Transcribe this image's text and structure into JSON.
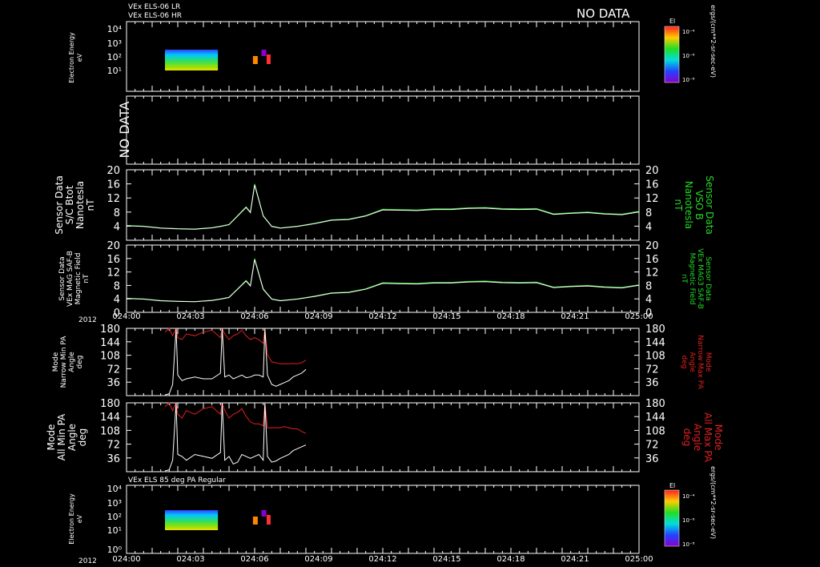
{
  "header": {
    "line1": "VEx ELS-06 LR",
    "line2": "VEx ELS-06 HR",
    "no_data": "NO DATA",
    "bottom_title": "VEx ELS 85 deg PA Regular",
    "flux_unit": "ergs/(cm**2-sr-sec-eV)",
    "year": "2012"
  },
  "colors": {
    "green": "#22dd22",
    "red": "#e02020",
    "white": "#ffffff",
    "frame": "#ffffff"
  },
  "colorbars": [
    {
      "label": "El",
      "ticks": [
        "10⁻⁴",
        "10⁻⁶",
        "10⁻⁸"
      ]
    },
    {
      "label": "El",
      "ticks": [
        "10⁻⁴",
        "10⁻⁶",
        "10⁻⁸"
      ]
    }
  ],
  "time_ticks": [
    "024:00",
    "024:03",
    "024:06",
    "024:09",
    "024:12",
    "024:15",
    "024:18",
    "024:21",
    "025:00"
  ],
  "panels": {
    "p1": {
      "ylabel": [
        "Electron Energy",
        "eV"
      ],
      "ticks": [
        "10⁴",
        "10³",
        "10²",
        "10¹"
      ]
    },
    "p2": {
      "ylabel": "NO DATA"
    },
    "p3": {
      "ylabel_left": [
        "Sensor Data",
        "S/C Btot",
        "Nanotesla",
        "nT"
      ],
      "ylabel_right": [
        "Sensor Data",
        "VSO B",
        "Nanotesla",
        "nT"
      ],
      "ticks": [
        "20",
        "16",
        "12",
        "8",
        "4"
      ]
    },
    "p4": {
      "ylabel_left": [
        "Sensor Data",
        "VEx MAG SAF-B",
        "Magnetic Field",
        "nT"
      ],
      "ylabel_right": [
        "Sensor Data",
        "VEx MAG3 SAF-B",
        "Magnetic Field",
        "nT"
      ],
      "ticks": [
        "20",
        "16",
        "12",
        "8",
        "4",
        "0"
      ]
    },
    "p5": {
      "ylabel_left": [
        "Mode",
        "Narrow Min PA",
        "Angle",
        "deg"
      ],
      "ylabel_right": [
        "Mode",
        "Narrow Max PA",
        "Angle",
        "deg"
      ],
      "ticks": [
        "180",
        "144",
        "108",
        "72",
        "36"
      ]
    },
    "p6": {
      "ylabel_left": [
        "Mode",
        "All Min PA",
        "Angle",
        "deg"
      ],
      "ylabel_right": [
        "Mode",
        "All Max PA",
        "Angle",
        "deg"
      ],
      "ticks": [
        "180",
        "144",
        "108",
        "72",
        "36"
      ]
    },
    "p7": {
      "ylabel": [
        "Electron Energy",
        "eV"
      ],
      "ticks": [
        "10⁴",
        "10³",
        "10²",
        "10¹",
        "10⁰"
      ]
    }
  },
  "chart_data": {
    "type": "line",
    "x_unit": "minutes after 024:00",
    "xlim": [
      0,
      60
    ],
    "spectrograms": [
      {
        "panel": "p1",
        "x_range": [
          4.5,
          10.7
        ],
        "energy_range_eV": [
          10,
          200
        ]
      },
      {
        "panel": "p7",
        "x_range": [
          4.5,
          10.7
        ],
        "energy_range_eV": [
          1,
          200
        ]
      }
    ],
    "b_field": {
      "ylim": [
        0,
        20
      ],
      "x": [
        0,
        2,
        4,
        6,
        8,
        10,
        11,
        12,
        13,
        14,
        14.5,
        15,
        16,
        17,
        18,
        20,
        22,
        24,
        26,
        28,
        30,
        32,
        34,
        36,
        38,
        40,
        42,
        44,
        46,
        48,
        50,
        52,
        54,
        56,
        58,
        60
      ],
      "values": [
        4.2,
        4,
        3.5,
        3.3,
        3.2,
        3.6,
        4,
        4.5,
        7,
        9.5,
        8,
        16,
        7,
        4,
        3.5,
        4,
        4.8,
        5.8,
        6,
        7,
        8.8,
        8.7,
        8.6,
        8.9,
        8.9,
        9.2,
        9.3,
        9,
        8.9,
        9,
        7.5,
        7.8,
        8,
        7.6,
        7.4,
        8.2
      ]
    },
    "narrow_pa": {
      "ylim": [
        0,
        180
      ],
      "x": [
        4.5,
        5,
        5.4,
        5.8,
        6,
        6.5,
        7,
        8,
        9,
        10,
        11,
        11.2,
        11.5,
        12,
        12.5,
        13,
        13.5,
        14,
        14.5,
        15,
        15.5,
        16,
        16.2,
        16.5,
        17,
        17.5,
        18,
        18.5,
        19,
        19.5,
        20,
        20.5,
        21
      ],
      "min": [
        2,
        5,
        30,
        180,
        55,
        40,
        45,
        50,
        45,
        45,
        60,
        180,
        50,
        55,
        45,
        50,
        55,
        48,
        50,
        55,
        55,
        50,
        180,
        55,
        30,
        25,
        30,
        35,
        40,
        50,
        55,
        60,
        70
      ],
      "max": [
        170,
        180,
        160,
        180,
        155,
        150,
        165,
        160,
        170,
        175,
        155,
        180,
        165,
        150,
        160,
        165,
        175,
        160,
        150,
        155,
        150,
        140,
        180,
        110,
        90,
        88,
        85,
        85,
        85,
        86,
        85,
        88,
        95
      ]
    },
    "all_pa": {
      "ylim": [
        0,
        180
      ],
      "x": [
        4.5,
        5,
        5.4,
        5.8,
        6,
        6.5,
        7,
        8,
        9,
        10,
        11,
        11.2,
        11.5,
        12,
        12.5,
        13,
        13.5,
        14,
        14.5,
        15,
        15.5,
        16,
        16.2,
        16.5,
        17,
        17.5,
        18,
        18.5,
        19,
        19.5,
        20,
        20.5,
        21
      ],
      "min": [
        2,
        5,
        30,
        180,
        45,
        40,
        30,
        45,
        40,
        35,
        50,
        180,
        30,
        40,
        20,
        25,
        45,
        40,
        35,
        40,
        45,
        30,
        180,
        40,
        25,
        28,
        35,
        40,
        45,
        55,
        60,
        65,
        70
      ],
      "max": [
        170,
        180,
        160,
        180,
        150,
        140,
        160,
        150,
        165,
        170,
        150,
        180,
        160,
        140,
        150,
        155,
        165,
        145,
        130,
        125,
        125,
        120,
        180,
        115,
        115,
        115,
        115,
        118,
        115,
        112,
        112,
        105,
        100
      ]
    }
  }
}
